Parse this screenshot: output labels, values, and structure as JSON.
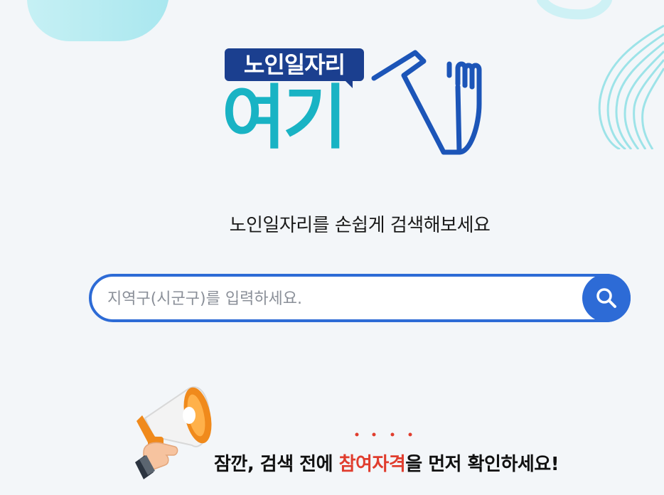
{
  "logo": {
    "small_text": "노인일자리",
    "big_text": "여기"
  },
  "subtitle": "노인일자리를 손쉽게 검색해보세요",
  "search": {
    "placeholder": "지역구(시군구)를 입력하세요.",
    "value": "",
    "button_icon": "search-icon"
  },
  "notice": {
    "prefix": "잠깐, 검색 전에 ",
    "highlight": "참여자격",
    "suffix": "을 먼저 확인하세요!",
    "icon": "megaphone-icon"
  },
  "colors": {
    "primary_blue": "#2d6bd6",
    "logo_navy": "#1b3f8f",
    "logo_teal": "#19b3c4",
    "highlight_red": "#e03d2e",
    "background": "#f3f6f9"
  }
}
